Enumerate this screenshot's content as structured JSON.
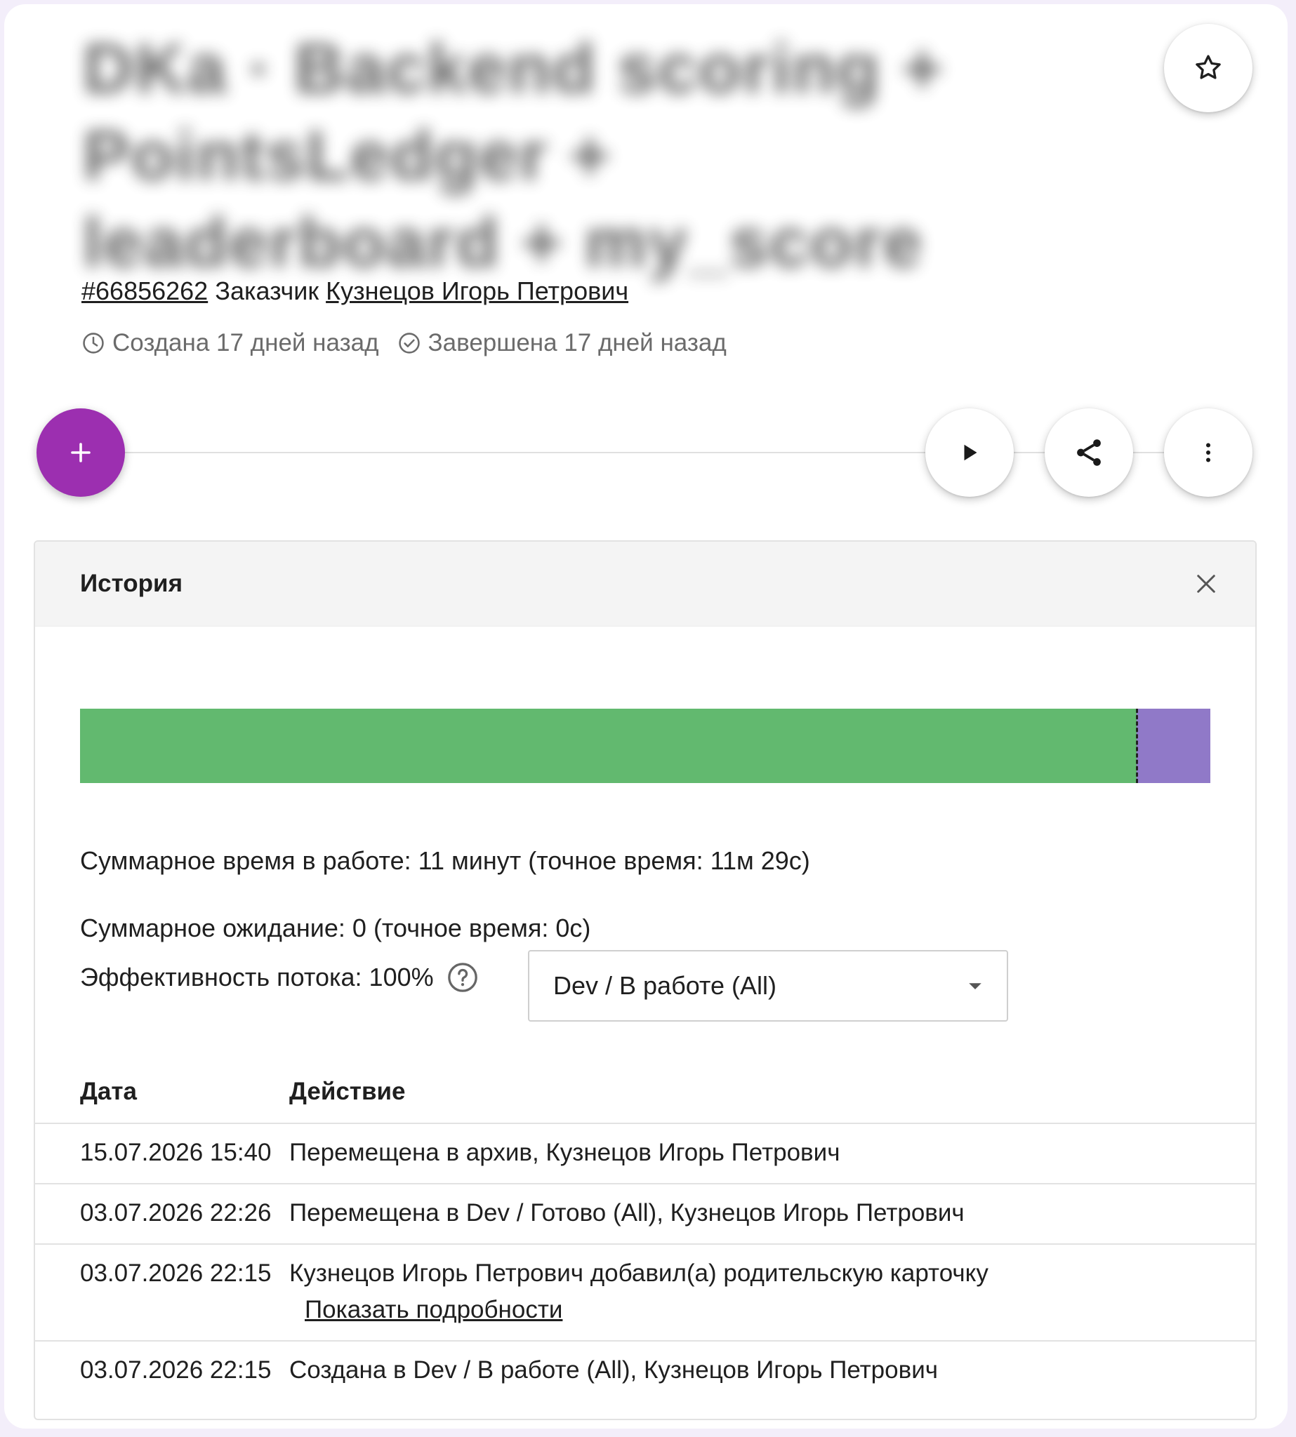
{
  "card": {
    "title": "DKa · Backend scoring + PointsLedger + leaderboard + my_score",
    "id": "#66856262",
    "customer_label": "Заказчик",
    "customer_name": "Кузнецов Игорь Петрович",
    "created": "Создана 17 дней назад",
    "completed": "Завершена 17 дней назад"
  },
  "icons": {
    "favorite": "star-outline-icon",
    "add": "plus-icon",
    "play": "play-icon",
    "share": "share-icon",
    "more": "more-vertical-icon",
    "created": "clock-icon",
    "completed": "check-circle-icon",
    "close": "close-icon",
    "help": "help-circle-icon",
    "dropdown": "caret-down-icon"
  },
  "colors": {
    "add_button": "#9c2fb0",
    "work_segment": "#62b96f",
    "done_segment": "#9079c8"
  },
  "history": {
    "title": "История",
    "timeline": {
      "segments": [
        {
          "state": "work",
          "share": 0.9346,
          "color": "#62b96f"
        },
        {
          "state": "done",
          "share": 0.0654,
          "color": "#9079c8"
        }
      ]
    },
    "total_work": "Суммарное время в работе: 11 минут (точное время: 11м 29с)",
    "total_wait": "Суммарное ожидание: 0 (точное время: 0с)",
    "flow_efficiency": "Эффективность потока: 100%",
    "filter_value": "Dev / В работе (All)",
    "columns": {
      "date": "Дата",
      "action": "Действие"
    },
    "rows": [
      {
        "date": "15.07.2026 15:40",
        "action": "Перемещена в архив, Кузнецов Игорь Петрович"
      },
      {
        "date": "03.07.2026 22:26",
        "action": "Перемещена в Dev / Готово (All), Кузнецов Игорь Петрович"
      },
      {
        "date": "03.07.2026 22:15",
        "action": "Кузнецов Игорь Петрович добавил(а) родительскую карточку",
        "link": "Показать подробности"
      },
      {
        "date": "03.07.2026 22:15",
        "action": "Создана в Dev / В работе (All), Кузнецов Игорь Петрович"
      }
    ]
  }
}
